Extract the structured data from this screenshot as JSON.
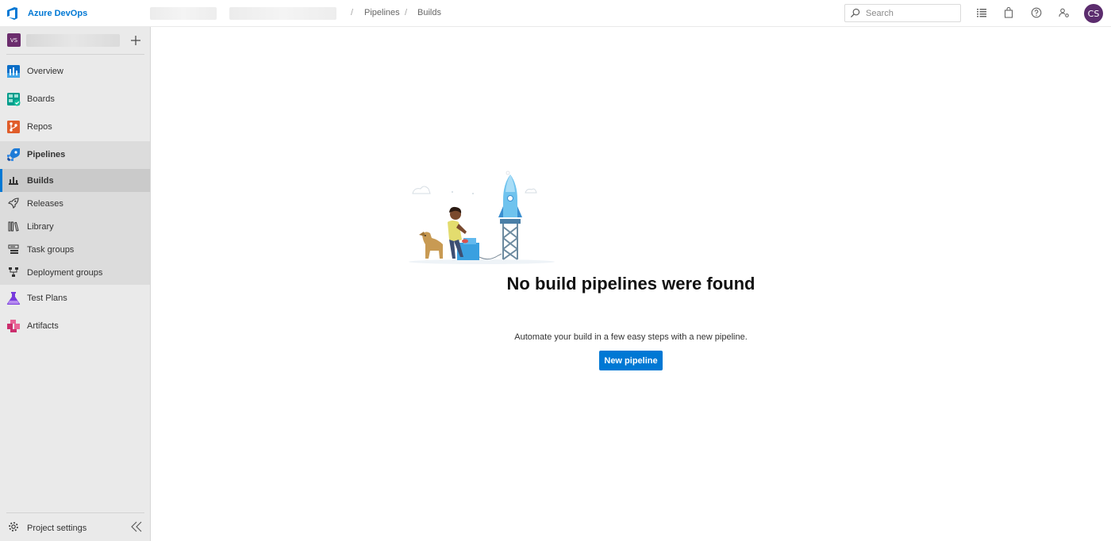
{
  "app": {
    "name": "Azure DevOps"
  },
  "breadcrumb": {
    "separator": "/",
    "items": [
      "Pipelines",
      "Builds"
    ]
  },
  "search": {
    "placeholder": "Search"
  },
  "user": {
    "initials": "CS"
  },
  "project": {
    "badge": "VS"
  },
  "sidebar": {
    "items": [
      {
        "label": "Overview",
        "icon": "overview-icon"
      },
      {
        "label": "Boards",
        "icon": "boards-icon"
      },
      {
        "label": "Repos",
        "icon": "repos-icon"
      },
      {
        "label": "Pipelines",
        "icon": "pipelines-icon"
      },
      {
        "label": "Test Plans",
        "icon": "test-plans-icon"
      },
      {
        "label": "Artifacts",
        "icon": "artifacts-icon"
      }
    ],
    "pipelines_sub": [
      {
        "label": "Builds",
        "icon": "builds-icon",
        "selected": true
      },
      {
        "label": "Releases",
        "icon": "rocket-icon"
      },
      {
        "label": "Library",
        "icon": "library-icon"
      },
      {
        "label": "Task groups",
        "icon": "task-groups-icon"
      },
      {
        "label": "Deployment groups",
        "icon": "deployment-groups-icon"
      }
    ],
    "settings_label": "Project settings"
  },
  "empty_state": {
    "title": "No build pipelines were found",
    "description": "Automate your build in a few easy steps with a new pipeline.",
    "button_label": "New pipeline"
  },
  "colors": {
    "accent": "#0078d4",
    "avatar": "#5c2d6e",
    "project_badge": "#6b2d6d",
    "sidebar_bg": "#eaeaea"
  }
}
